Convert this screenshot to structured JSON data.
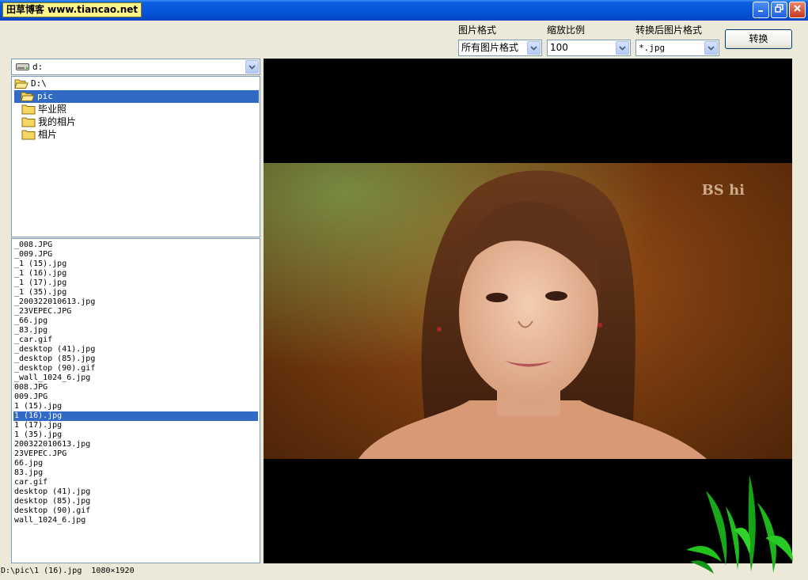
{
  "titlebar": {
    "watermark": "田草博客 www.tiancao.net"
  },
  "toolbar": {
    "format_label": "图片格式",
    "format_value": "所有图片格式",
    "scale_label": "缩放比例",
    "scale_value": "100",
    "target_format_label": "转换后图片格式",
    "target_format_value": "*.jpg",
    "convert_label": "转换"
  },
  "drive": {
    "value": "d:"
  },
  "tree": {
    "items": [
      {
        "label": "D:\\",
        "level": 0,
        "selected": false,
        "open": true
      },
      {
        "label": "pic",
        "level": 1,
        "selected": true,
        "open": true
      },
      {
        "label": "毕业照",
        "level": 2,
        "selected": false,
        "open": false
      },
      {
        "label": "我的相片",
        "level": 2,
        "selected": false,
        "open": false
      },
      {
        "label": "相片",
        "level": 2,
        "selected": false,
        "open": false
      }
    ]
  },
  "files": {
    "selected_index": 18,
    "items": [
      "_008.JPG",
      "_009.JPG",
      "_1 (15).jpg",
      "_1 (16).jpg",
      "_1 (17).jpg",
      "_1 (35).jpg",
      "_200322010613.jpg",
      "_23VEPEC.JPG",
      "_66.jpg",
      "_83.jpg",
      "_car.gif",
      "_desktop (41).jpg",
      "_desktop (85).jpg",
      "_desktop (90).gif",
      "_wall_1024_6.jpg",
      "008.JPG",
      "009.JPG",
      "1 (15).jpg",
      "1 (16).jpg",
      "1 (17).jpg",
      "1 (35).jpg",
      "200322010613.jpg",
      "23VEPEC.JPG",
      "66.jpg",
      "83.jpg",
      "car.gif",
      "desktop (41).jpg",
      "desktop (85).jpg",
      "desktop (90).gif",
      "wall_1024_6.jpg"
    ]
  },
  "preview": {
    "photo_tag": "BS hi"
  },
  "status": {
    "path": "D:\\pic\\1 (16).jpg",
    "dimensions": "1080×1920"
  },
  "colors": {
    "selection": "#316ac5",
    "titlebar": "#0553d6",
    "window_bg": "#ece9d8"
  }
}
